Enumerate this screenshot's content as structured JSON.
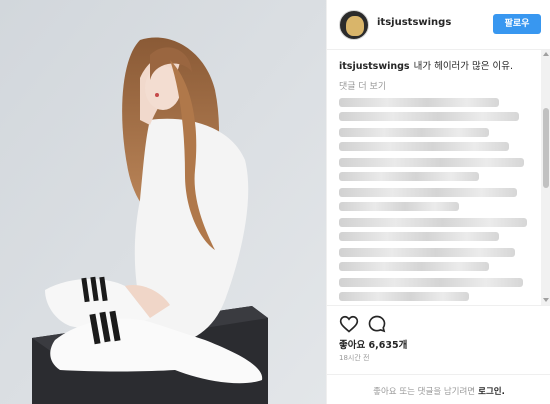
{
  "post": {
    "username": "itsjustswings",
    "follow_label": "팔로우",
    "caption_text": "내가 헤이러가 많은 이유.",
    "more_comments_label": "댓글 더 보기",
    "likes_text": "좋아요 6,635개",
    "timestamp": "18시간 전",
    "add_comment_text": "좋아요 또는 댓글을 남기려면",
    "login_label": "로그인."
  },
  "icons": {
    "like": "heart-icon",
    "comment": "comment-bubble-icon"
  },
  "colors": {
    "follow_button": "#3897f0",
    "secondary_text": "#999999",
    "photo_background": "#d9dde1"
  }
}
